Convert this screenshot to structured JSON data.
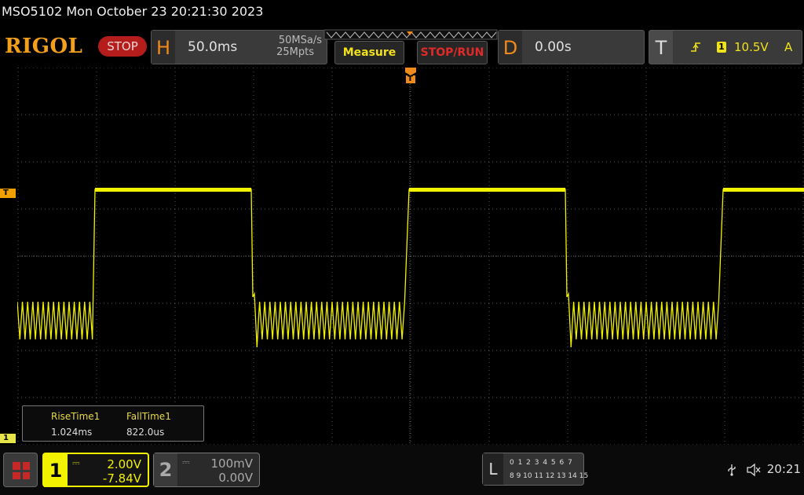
{
  "status": {
    "title": "MSO5102  Mon October 23 20:21:30 2023",
    "time": "20:21"
  },
  "header": {
    "logo": "RIGOL",
    "run_state": "STOP",
    "horizontal": {
      "letter": "H",
      "timebase": "50.0ms",
      "sample_rate": "50MSa/s",
      "memory_depth": "25Mpts"
    },
    "measure_label": "Measure",
    "stop_run_label": "STOP/RUN",
    "delay": {
      "letter": "D",
      "value": "0.00s"
    },
    "trigger": {
      "letter": "T",
      "source": "1",
      "level": "10.5V",
      "mode": "A",
      "slope_icon": "rising-edge-icon"
    }
  },
  "markers": {
    "trigger_level": "T",
    "channel1": "1",
    "trigger_position": "T"
  },
  "measurements": {
    "items": [
      {
        "label": "RiseTime1",
        "value": "1.024ms"
      },
      {
        "label": "FallTime1",
        "value": "822.0us"
      }
    ]
  },
  "channels": [
    {
      "num": "1",
      "scale": "2.00V",
      "offset": "-7.84V",
      "coupling_icon": "dc-coupling-icon",
      "color": "#f2f200",
      "active": true
    },
    {
      "num": "2",
      "scale": "100mV",
      "offset": "0.00V",
      "coupling_icon": "dc-coupling-icon",
      "color": "#00d0d0",
      "active": false
    }
  ],
  "logic": {
    "letter": "L",
    "row1": "0 1 2 3   4 5 6 7",
    "row2": "8 9 10 11 12 13 14 15"
  },
  "colors": {
    "accent_orange": "#f08a1a",
    "trace_yellow": "#f2f200",
    "stop_red": "#b51c1c"
  }
}
